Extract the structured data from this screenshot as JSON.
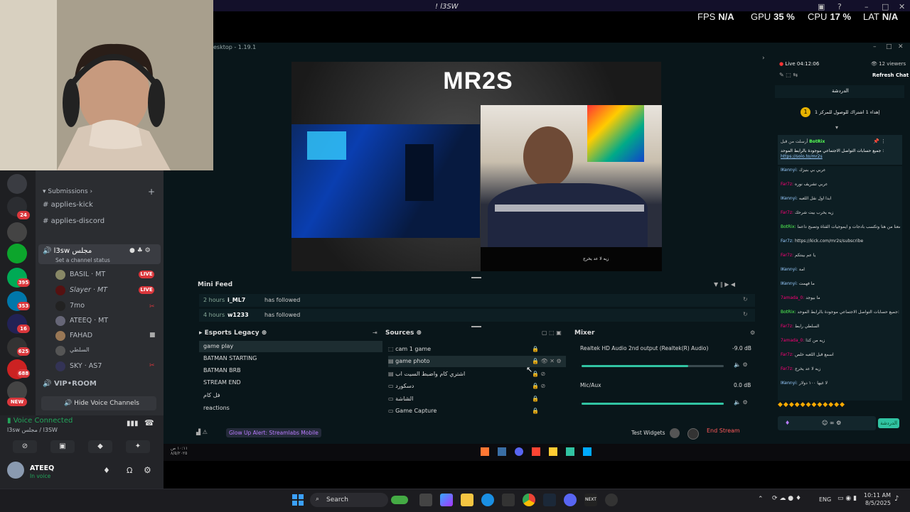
{
  "top": {
    "title": "! l3SW",
    "stats": [
      {
        "label": "FPS",
        "value": "N/A"
      },
      {
        "label": "GPU",
        "value": "35 %"
      },
      {
        "label": "CPU",
        "value": "17 %"
      },
      {
        "label": "LAT",
        "value": "N/A"
      }
    ]
  },
  "discord": {
    "servers_badges": [
      "24",
      "395",
      "353",
      "16",
      "625",
      "688"
    ],
    "new_badge": "NEW",
    "category_submissions": "Submissions",
    "channels": [
      "applies-kick",
      "applies-discord"
    ],
    "voice_channel": "l3sw مجلس",
    "channel_status": "Set a channel status",
    "members": [
      {
        "name": "BASIL",
        "tag": "MT",
        "live": "LIVE"
      },
      {
        "name": "Slayer",
        "tag": "MT",
        "live": "LIVE"
      },
      {
        "name": "7mo",
        "tag": "",
        "live": ""
      },
      {
        "name": "ATEEQ",
        "tag": "MT",
        "live": ""
      },
      {
        "name": "FAHAD",
        "tag": "",
        "live": ""
      },
      {
        "name": "السلطي",
        "tag": "",
        "live": ""
      },
      {
        "name": "SKY",
        "tag": "AS7",
        "live": ""
      }
    ],
    "vip_room": "VIP•ROOM",
    "hide_voice": "Hide Voice Channels",
    "voice_connected": "Voice Connected",
    "voice_sub": "l3sw مجلس / l3SW",
    "user_name": "ATEEQ",
    "user_status": "In voice"
  },
  "slobs": {
    "title": "esktop - 1.19.1",
    "overlay_name": "MR2S",
    "overlay_caption": "زيه لا عد يخرج",
    "mini_feed": {
      "title": "Mini Feed",
      "rows": [
        {
          "time": "2 hours",
          "user": "i_ML7",
          "event": "has followed"
        },
        {
          "time": "4 hours",
          "user": "w1233",
          "event": "has followed"
        }
      ]
    },
    "scenes": {
      "title": "Esports Legacy",
      "items": [
        "game play",
        "BATMAN STARTING",
        "BATMAN BRB",
        "STREAM END",
        "فل كام",
        "reactions"
      ]
    },
    "sources": {
      "title": "Sources",
      "items": [
        "cam 1 game",
        "game photo",
        "اشتري كام واضبط السيت اب",
        "دسكورد",
        "الشاشة",
        "Game Capture"
      ]
    },
    "mixer": {
      "title": "Mixer",
      "channels": [
        {
          "name": "Realtek HD Audio 2nd output (Realtek(R) Audio)",
          "db": "-9.0 dB",
          "level": 0.75
        },
        {
          "name": "Mic/Aux",
          "db": "0.0 dB",
          "level": 1.0
        }
      ]
    },
    "alert": "Glow Up Alert: Streamlabs Mobile",
    "test_widgets": "Test Widgets",
    "end_stream": "End Stream"
  },
  "chat": {
    "live_time": "Live 04:12:06",
    "viewers": "12 viewers",
    "refresh": "Refresh Chat",
    "tab": "الدردشة",
    "pinned_goal": "إهداء 1 اشتراك للوصول للمركز 1",
    "pinned_by": "أرسلت من قبل",
    "pinned_user": "BotRix",
    "pinned_msg": "جميع حسابات التواصل الاجتماعي موجودة بالرابط الموحد :",
    "pinned_link": "https://solo.to/mr2s",
    "messages": [
      {
        "user": "IKennyi:",
        "text": "عربي بي بنيزك",
        "cls": "u2"
      },
      {
        "user": "",
        "text": "عربي تشريف نوره",
        "cls": "u"
      },
      {
        "user": "IKennyi:",
        "text": "ابدا اول نقل اللعبه",
        "cls": "u2"
      },
      {
        "user": "",
        "text": "زيه يخرب بيت شرحك",
        "cls": "u"
      },
      {
        "user": "BotRix:",
        "text": "اشترك معنا من هنا وتكسب بادجات و ايموجيات القناة وتصبح داعماً",
        "cls": "bot"
      },
      {
        "user": "",
        "text": "https://kick.com/mr2s/subscribe",
        "cls": "u2"
      },
      {
        "user": "",
        "text": "يا عم بينتكم",
        "cls": "u"
      },
      {
        "user": "IKennyi:",
        "text": "امة",
        "cls": "u2"
      },
      {
        "user": "IKennyi:",
        "text": "ما فهمت",
        "cls": "u2"
      },
      {
        "user": "7amada_0:",
        "text": "ما بيوجد",
        "cls": "u"
      },
      {
        "user": "BotRix:",
        "text": "جميع حسابات التواصل الاجتماعي موجودة بالرابط الموحد: https://solo.to/mr2s",
        "cls": "bot"
      },
      {
        "user": "",
        "text": "السلطي رابط",
        "cls": "u"
      },
      {
        "user": "7amada_0:",
        "text": "زيه من كذا",
        "cls": "u"
      },
      {
        "user": "",
        "text": "اسمع قبل اللعبه خلص",
        "cls": "u"
      },
      {
        "user": "",
        "text": "زيه لا عد يخرج",
        "cls": "u"
      },
      {
        "user": "IKennyi:",
        "text": "لا غيها ١٠٠ دولار",
        "cls": "u2"
      }
    ],
    "send": "الدردشة"
  },
  "taskbar": {
    "search": "Search",
    "lang": "ENG",
    "time": "10:11 AM",
    "date": "8/5/2025"
  },
  "colors": {
    "accent": "#31c3a2",
    "live": "#da373c",
    "end_stream": "#ff5a5a"
  }
}
